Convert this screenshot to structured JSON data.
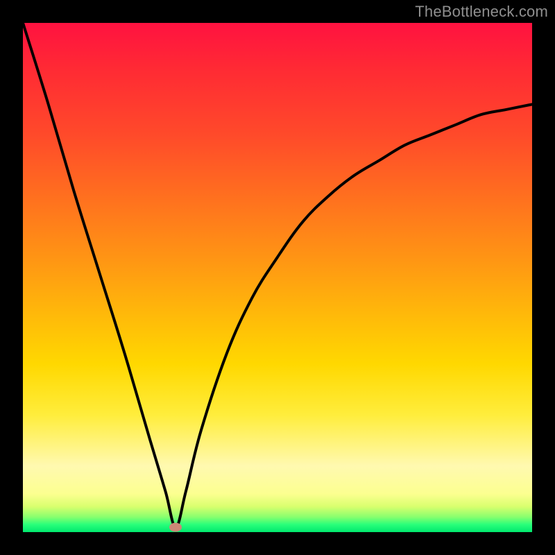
{
  "watermark": "TheBottleneck.com",
  "colors": {
    "background": "#000000",
    "curve": "#000000",
    "marker": "#cc8776",
    "gradient_top": "#ff1240",
    "gradient_bottom": "#00e96e"
  },
  "chart_data": {
    "type": "line",
    "title": "",
    "xlabel": "",
    "ylabel": "",
    "xlim": [
      0,
      100
    ],
    "ylim": [
      0,
      100
    ],
    "legend": false,
    "grid": false,
    "annotations": [],
    "marker": {
      "x": 30,
      "y": 1
    },
    "series": [
      {
        "name": "bottleneck-curve",
        "x": [
          0,
          5,
          10,
          15,
          20,
          25,
          28,
          30,
          32,
          35,
          40,
          45,
          50,
          55,
          60,
          65,
          70,
          75,
          80,
          85,
          90,
          95,
          100
        ],
        "y": [
          100,
          84,
          67,
          51,
          35,
          18,
          8,
          1,
          8,
          20,
          35,
          46,
          54,
          61,
          66,
          70,
          73,
          76,
          78,
          80,
          82,
          83,
          84
        ]
      }
    ]
  }
}
